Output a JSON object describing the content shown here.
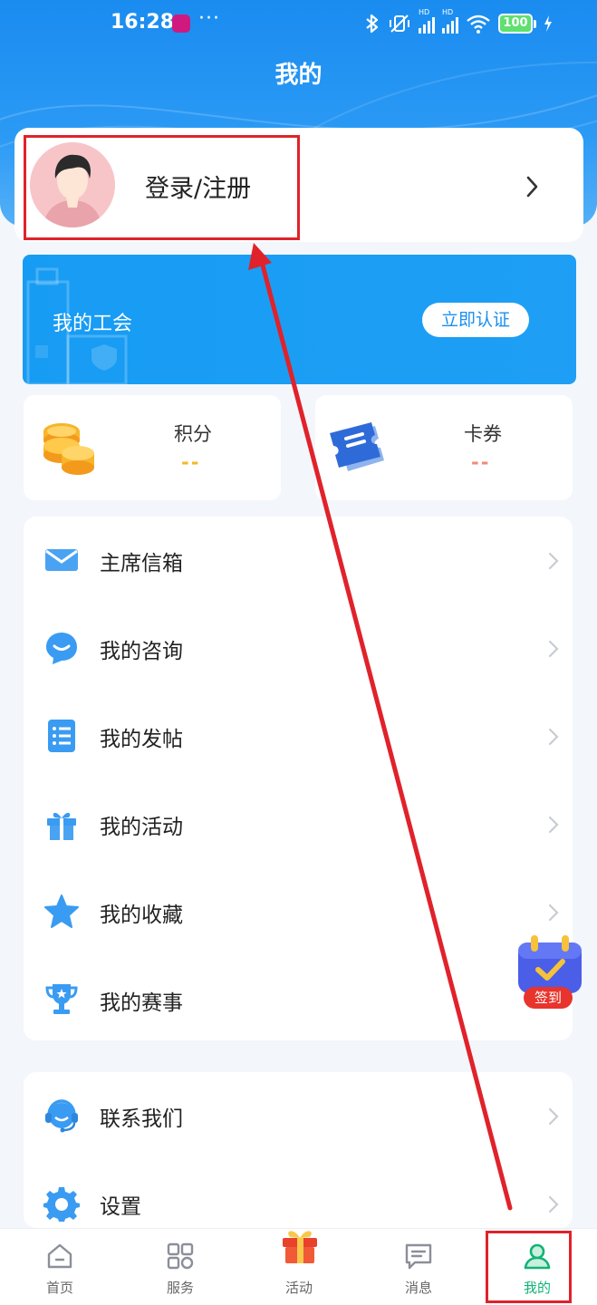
{
  "status_bar": {
    "time": "16:28",
    "more": "···",
    "network": "HD",
    "battery": "100"
  },
  "header": {
    "title": "我的"
  },
  "login": {
    "label": "登录/注册"
  },
  "union": {
    "label": "我的工会",
    "button": "立即认证"
  },
  "stats": {
    "points": {
      "label": "积分",
      "value": "--",
      "color": "#f2b92b"
    },
    "coupons": {
      "label": "卡券",
      "value": "--",
      "color": "#f08a7e"
    }
  },
  "menu": {
    "items": [
      {
        "label": "主席信箱",
        "icon": "mail-icon"
      },
      {
        "label": "我的咨询",
        "icon": "chat-bubble-icon"
      },
      {
        "label": "我的发帖",
        "icon": "list-document-icon"
      },
      {
        "label": "我的活动",
        "icon": "gift-box-icon"
      },
      {
        "label": "我的收藏",
        "icon": "star-icon"
      },
      {
        "label": "我的赛事",
        "icon": "trophy-icon"
      }
    ]
  },
  "menu2": {
    "items": [
      {
        "label": "联系我们",
        "icon": "headset-icon"
      },
      {
        "label": "设置",
        "icon": "gear-icon"
      }
    ]
  },
  "checkin": {
    "label": "签到"
  },
  "nav": {
    "items": [
      {
        "label": "首页",
        "icon": "home-icon"
      },
      {
        "label": "服务",
        "icon": "grid-icon"
      },
      {
        "label": "活动",
        "icon": "gift-icon"
      },
      {
        "label": "消息",
        "icon": "message-icon"
      },
      {
        "label": "我的",
        "icon": "user-icon",
        "active": true
      }
    ]
  },
  "colors": {
    "primary": "#1a8cf0",
    "active_tab": "#12b276",
    "annotation": "#e0222b"
  }
}
